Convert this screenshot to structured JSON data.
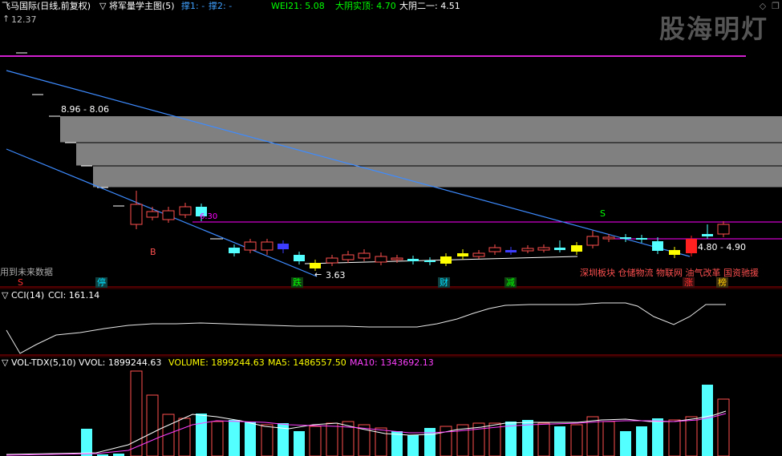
{
  "header": {
    "title": "飞马国际(日线,前复权)",
    "indicator": "▽ 将军量学主图(5)",
    "support1": "撑1: -",
    "support2": "撑2: -",
    "wei21": "WEI21: 5.08",
    "dayin_shiding": "大阴实顶: 4.70",
    "dayin_eryi": "大阴二一: 4.51",
    "watermark": "股海明灯",
    "window_icons": [
      "diamond-icon",
      "restore-icon"
    ]
  },
  "price_panel": {
    "high_label": "12.37",
    "zone_label": "8.96 - 8.06",
    "note_630": "6.30",
    "low_label": "3.63",
    "right_zone_label": "4.80 - 4.90",
    "sell_marker": "S",
    "buy_marker": "B",
    "future_data_note": "用到未来数据",
    "markers": [
      {
        "text": "S",
        "color": "#ff3030"
      },
      {
        "text": "停",
        "color": "#00e0ff"
      },
      {
        "text": "跌",
        "color": "#00ff00"
      },
      {
        "text": "财",
        "color": "#00e0ff"
      },
      {
        "text": "减",
        "color": "#00ff00"
      },
      {
        "text": "涨",
        "color": "#ff3030"
      },
      {
        "text": "榜",
        "color": "#ffcc00"
      }
    ],
    "concepts": "深圳板块 仓储物流 物联网 油气改革 国资驰援"
  },
  "cci_panel": {
    "name": "▽ CCI(14)",
    "value": "CCI: 161.14"
  },
  "vol_panel": {
    "name": "▽ VOL-TDX(5,10)",
    "vvol": "VVOL: 1899244.63",
    "volume": "VOLUME: 1899244.63",
    "ma5": "MA5: 1486557.50",
    "ma10": "MA10: 1343692.13"
  },
  "colors": {
    "up": "#ff5050",
    "down": "#54ffff",
    "yellow": "#ffff00",
    "magenta": "#ff00ff",
    "panel_line": "#a00000",
    "trend": "#3d8bff",
    "gray_zone": "#808080"
  }
}
